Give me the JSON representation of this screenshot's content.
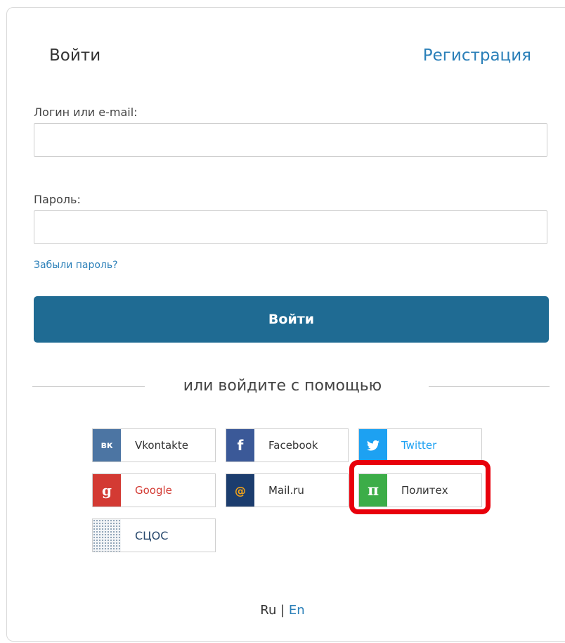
{
  "header": {
    "login_tab": "Войти",
    "register_link": "Регистрация"
  },
  "form": {
    "login_label": "Логин или e-mail:",
    "login_value": "",
    "password_label": "Пароль:",
    "password_value": "",
    "forgot_link": "Забыли пароль?",
    "submit_label": "Войти"
  },
  "divider": {
    "text": "или войдите с помощью"
  },
  "social": [
    {
      "label": "Vkontakte",
      "icon": "vk-icon",
      "glyph": "вк",
      "color": "#4c75a3",
      "text_color": "#333333"
    },
    {
      "label": "Facebook",
      "icon": "facebook-icon",
      "glyph": "f",
      "color": "#3b5998",
      "text_color": "#333333"
    },
    {
      "label": "Twitter",
      "icon": "twitter-icon",
      "glyph": "🐦",
      "color": "#1da1f2",
      "text_color": "#1da1f2"
    },
    {
      "label": "Google",
      "icon": "google-icon",
      "glyph": "g",
      "color": "#d33a33",
      "text_color": "#d33a33"
    },
    {
      "label": "Mail.ru",
      "icon": "mailru-icon",
      "glyph": "@",
      "color": "#1c3d6e",
      "text_color": "#333333"
    },
    {
      "label": "Политех",
      "icon": "pi-icon",
      "glyph": "π",
      "color": "#3cad48",
      "text_color": "#333333"
    },
    {
      "label": "СЦОС",
      "icon": "scos-icon",
      "glyph": "",
      "color": "#dfe6ea",
      "text_color": "#2a4a6e"
    }
  ],
  "language": {
    "ru": "Ru",
    "separator": " | ",
    "en": "En"
  },
  "annotation": {
    "highlight_color": "#e8000b"
  }
}
